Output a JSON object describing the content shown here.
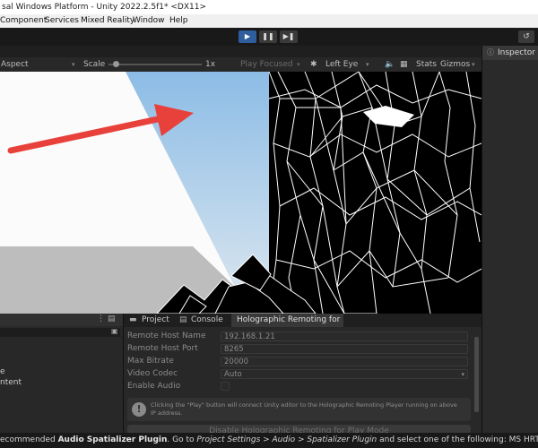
{
  "window": {
    "title": "sal Windows Platform - Unity 2022.2.5f1* <DX11>"
  },
  "menu": {
    "items": [
      "Component",
      "Services",
      "Mixed Reality",
      "Window",
      "Help"
    ]
  },
  "toolbar": {
    "play_icon": "▶",
    "pause_icon": "❚❚",
    "step_icon": "▶❚",
    "history_icon": "↺"
  },
  "game_toolbar": {
    "aspect": "Aspect",
    "scale_label": "Scale",
    "scale_value": "1x",
    "play_focused": "Play Focused",
    "left_eye": "Left Eye",
    "stats": "Stats",
    "gizmos": "Gizmos",
    "scale_level": 0.08
  },
  "inspector": {
    "tab_label": "Inspector"
  },
  "left_panel": {
    "items": [
      "e",
      "ntent"
    ]
  },
  "bottom_tabs": [
    "Project",
    "Console",
    "Holographic Remoting for ..."
  ],
  "remoting": {
    "rows": [
      {
        "label": "Remote Host Name",
        "value": "192.168.1.21"
      },
      {
        "label": "Remote Host Port",
        "value": "8265"
      },
      {
        "label": "Max Bitrate",
        "value": "20000"
      },
      {
        "label": "Video Codec",
        "value": "Auto"
      },
      {
        "label": "Enable Audio",
        "value": ""
      }
    ],
    "help_line1": "Clicking the \"Play\" button will connect Unity editor to the Holographic Remoting Player running on above",
    "help_line2": "IP address.",
    "disable_button": "Disable Holographic Remoting for Play Mode"
  },
  "status": {
    "pre": "ecommended ",
    "b1": "Audio Spatializer Plugin",
    "mid1": ". Go to ",
    "i1": "Project Settings > Audio > Spatializer Plugin",
    "post": " and select one of the following: MS HRTF Spatializer, Mic"
  },
  "colors": {
    "accent": "#2f5e9e",
    "arrow": "#e8403a",
    "sky_top": "#8cbce6",
    "sky_bottom": "#dde8ef"
  }
}
